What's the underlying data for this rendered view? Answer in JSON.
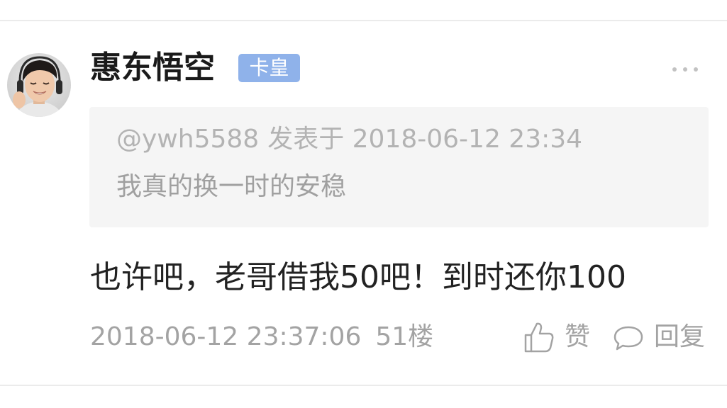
{
  "post": {
    "author": "惠东悟空",
    "badge": "卡皇",
    "quote": {
      "user": "@ywh5588",
      "posted_at": "发表于 2018-06-12 23:34",
      "text": "我真的换一时的安稳"
    },
    "content": "也许吧，老哥借我50吧！到时还你100",
    "timestamp": "2018-06-12 23:37:06",
    "floor": "51楼",
    "actions": {
      "like_label": "赞",
      "reply_label": "回复"
    }
  },
  "icons": {
    "more": "more-dots-icon",
    "like": "thumbs-up-icon",
    "reply": "speech-bubble-icon"
  },
  "colors": {
    "badge_bg": "#8fb2ea",
    "quote_bg": "#f5f5f5",
    "meta_text": "#a3a3a3",
    "author_text": "#1a1a1a"
  }
}
